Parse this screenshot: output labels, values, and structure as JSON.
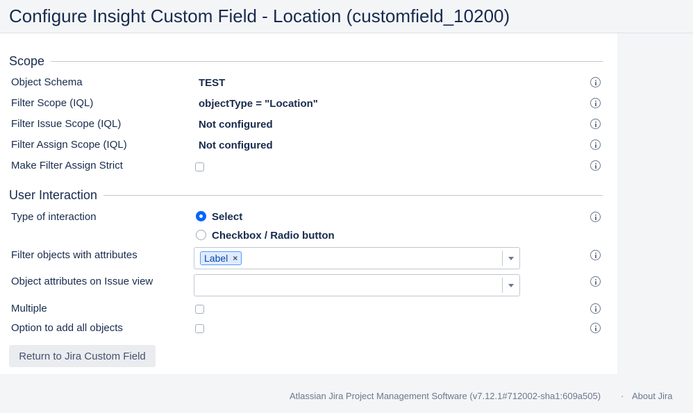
{
  "page": {
    "title": "Configure Insight Custom Field - Location (customfield_10200)"
  },
  "scope": {
    "title": "Scope",
    "rows": [
      {
        "label": "Object Schema",
        "value": "TEST"
      },
      {
        "label": "Filter Scope (IQL)",
        "value": "objectType = \"Location\""
      },
      {
        "label": "Filter Issue Scope (IQL)",
        "value": "Not configured"
      },
      {
        "label": "Filter Assign Scope (IQL)",
        "value": "Not configured"
      },
      {
        "label": "Make Filter Assign Strict",
        "checked": false
      }
    ]
  },
  "user_interaction": {
    "title": "User Interaction",
    "type_label": "Type of interaction",
    "options": [
      {
        "label": "Select",
        "selected": true
      },
      {
        "label": "Checkbox / Radio button",
        "selected": false
      }
    ],
    "filter_attributes": {
      "label": "Filter objects with attributes",
      "tags": [
        "Label"
      ],
      "tag_remove_glyph": "×"
    },
    "issue_view_attributes": {
      "label": "Object attributes on Issue view",
      "tags": []
    },
    "multiple": {
      "label": "Multiple",
      "checked": false
    },
    "add_all": {
      "label": "Option to add all objects",
      "checked": false
    }
  },
  "actions": {
    "return_label": "Return to Jira Custom Field"
  },
  "footer": {
    "software": "Atlassian Jira Project Management Software (v7.12.1#712002-sha1:609a505)",
    "separator": "·",
    "about": "About Jira"
  },
  "colors": {
    "accent": "#0065ff",
    "text": "#172b4d",
    "tag_bg": "#deebff"
  }
}
